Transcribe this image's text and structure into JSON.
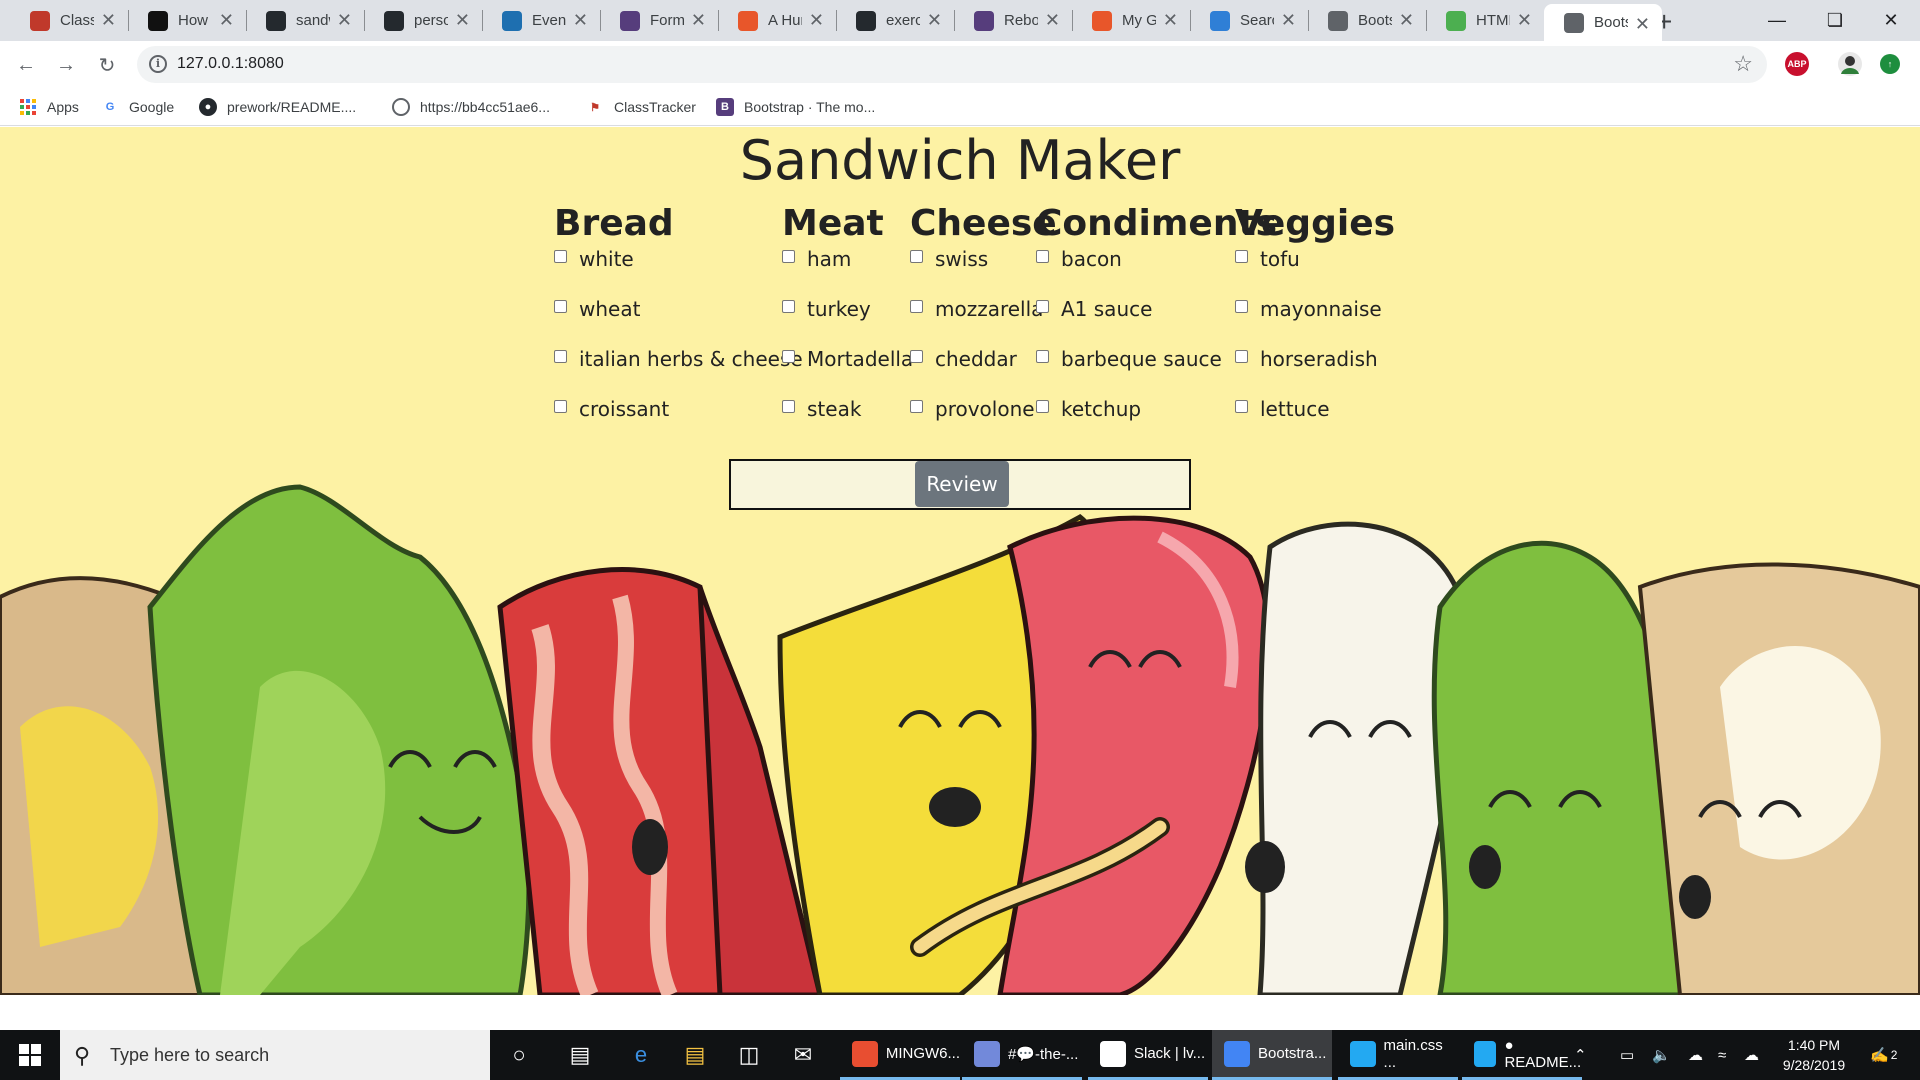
{
  "browser": {
    "tabs": [
      {
        "title": "ClassTracker",
        "icon": "classtracker-icon",
        "color": "#c0392b"
      },
      {
        "title": "How to",
        "icon": "htg-icon",
        "color": "#111111"
      },
      {
        "title": "sandwich",
        "icon": "github-icon",
        "color": "#24292e"
      },
      {
        "title": "personal",
        "icon": "github-icon",
        "color": "#24292e"
      },
      {
        "title": "Events",
        "icon": "eventbrite-icon",
        "color": "#1e6fb0"
      },
      {
        "title": "Forms",
        "icon": "bootstrap-icon",
        "color": "#563d7c"
      },
      {
        "title": "A Hundred",
        "icon": "codepen-icon",
        "color": "#e8562a"
      },
      {
        "title": "exercises",
        "icon": "github-icon",
        "color": "#24292e"
      },
      {
        "title": "Reboot",
        "icon": "bootstrap-icon",
        "color": "#563d7c"
      },
      {
        "title": "My Gists",
        "icon": "codepen-icon",
        "color": "#e8562a"
      },
      {
        "title": "Search",
        "icon": "w-icon",
        "color": "#2f7fd6"
      },
      {
        "title": "Bootstrap",
        "icon": "globe-icon",
        "color": "#5f6368"
      },
      {
        "title": "HTML",
        "icon": "w3-icon",
        "color": "#4caf50"
      },
      {
        "title": "Bootstrap",
        "icon": "globe-icon",
        "color": "#5f6368",
        "active": true
      }
    ],
    "url": "127.0.0.1:8080",
    "bookmarks": [
      {
        "label": "Apps"
      },
      {
        "label": "Google"
      },
      {
        "label": "prework/README...."
      },
      {
        "label": "https://bb4cc51ae6..."
      },
      {
        "label": "ClassTracker"
      },
      {
        "label": "Bootstrap · The mo..."
      }
    ],
    "extensions": {
      "adblock_label": "ABP"
    }
  },
  "page": {
    "title": "Sandwich Maker",
    "background_color": "#fdf2a4",
    "columns": [
      {
        "heading": "Bread",
        "options": [
          "white",
          "wheat",
          "italian herbs & cheese",
          "croissant"
        ]
      },
      {
        "heading": "Meat",
        "options": [
          "ham",
          "turkey",
          "Mortadella",
          "steak"
        ]
      },
      {
        "heading": "Cheese",
        "options": [
          "swiss",
          "mozzarella",
          "cheddar",
          "provolone"
        ]
      },
      {
        "heading": "Condiments",
        "options": [
          "bacon",
          "A1 sauce",
          "barbeque sauce",
          "ketchup"
        ]
      },
      {
        "heading": "Veggies",
        "options": [
          "tofu",
          "mayonnaise",
          "horseradish",
          "lettuce"
        ]
      }
    ],
    "review_button": "Review"
  },
  "taskbar": {
    "search_placeholder": "Type here to search",
    "apps": [
      {
        "label": "MINGW6...",
        "icon": "git-icon",
        "color": "#e84e31"
      },
      {
        "label": "#💬-the-...",
        "icon": "discord-icon",
        "color": "#7289da"
      },
      {
        "label": "Slack | lv...",
        "icon": "slack-icon",
        "color": "#ffffff"
      },
      {
        "label": "Bootstra...",
        "icon": "chrome-icon",
        "color": "#4285f4",
        "active": true
      },
      {
        "label": "main.css ...",
        "icon": "vscode-icon",
        "color": "#23a9f2"
      },
      {
        "label": "● README...",
        "icon": "vscode-icon",
        "color": "#23a9f2"
      }
    ],
    "time": "1:40 PM",
    "date": "9/28/2019",
    "notification_count": "2"
  }
}
